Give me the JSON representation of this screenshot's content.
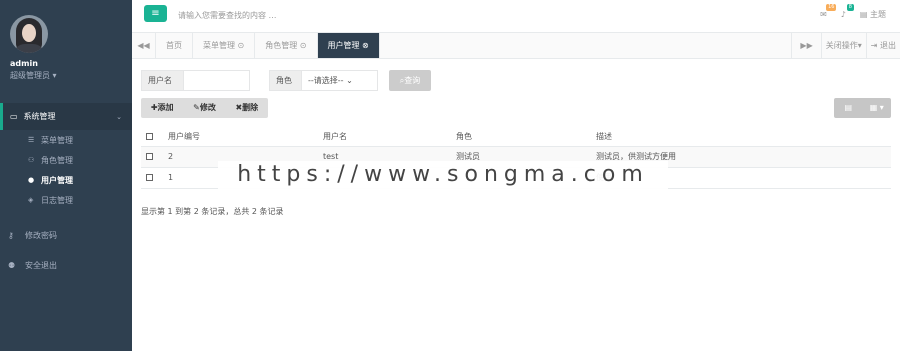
{
  "sidebar": {
    "profile": {
      "name": "admin",
      "role": "超级管理员 ▾"
    },
    "section": {
      "label": "系统管理",
      "icon": "monitor-icon",
      "caret": "⌄"
    },
    "subitems": [
      {
        "label": "菜单管理",
        "icon": "sliders-icon"
      },
      {
        "label": "角色管理",
        "icon": "users-icon"
      },
      {
        "label": "用户管理",
        "icon": "user-icon",
        "active": true
      },
      {
        "label": "日志管理",
        "icon": "tag-icon"
      }
    ],
    "items": [
      {
        "label": "修改密码",
        "icon": "key-icon"
      },
      {
        "label": "安全退出",
        "icon": "user-logout-icon"
      }
    ]
  },
  "topbar": {
    "menu_icon": "≡",
    "search_placeholder": "请输入您需要查找的内容 …",
    "mail_badge": "16",
    "bell_badge": "8",
    "theme_label": "主题"
  },
  "tabbar": {
    "tabs": [
      {
        "label": "首页"
      },
      {
        "label": "菜单管理 ⊙"
      },
      {
        "label": "角色管理 ⊙"
      },
      {
        "label": "用户管理 ⊗",
        "active": true
      }
    ],
    "close_ops": "关闭操作▾",
    "logout": "退出"
  },
  "filters": {
    "username_label": "用户名",
    "username_value": "",
    "role_label": "角色",
    "role_selected": "--请选择--",
    "search_button": "查询"
  },
  "toolbar": {
    "add": "✚添加",
    "edit": "✎修改",
    "delete": "✖删除"
  },
  "table": {
    "headers": [
      "用户编号",
      "用户名",
      "角色",
      "描述"
    ],
    "rows": [
      [
        "2",
        "test",
        "测试员",
        "测试员，供测试方便用"
      ],
      [
        "1",
        "",
        "",
        "使用"
      ]
    ]
  },
  "pagination": "显示第 1 到第 2 条记录，总共 2 条记录",
  "watermark": "https://www.songma.com",
  "colors": {
    "sidebar": "#2f4050",
    "accent": "#1ab394"
  }
}
